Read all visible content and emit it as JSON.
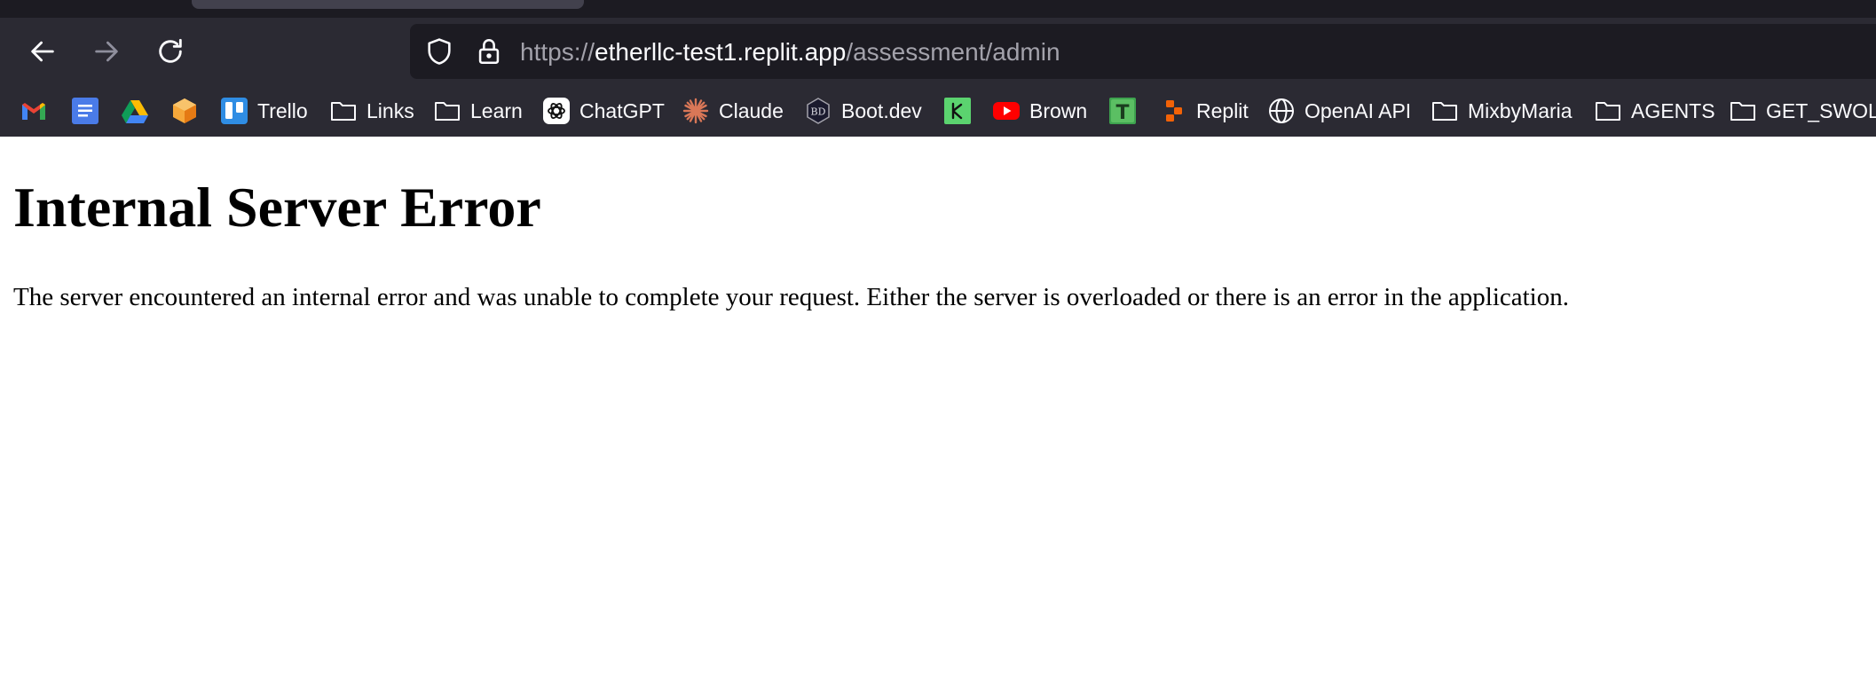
{
  "browser": {
    "url": {
      "scheme": "https://",
      "host": "etherllc-test1.replit.app",
      "path": "/assessment/admin"
    },
    "icons": {
      "back": "back-arrow-icon",
      "forward": "forward-arrow-icon",
      "reload": "reload-icon",
      "shield": "shield-icon",
      "lock": "lock-icon"
    },
    "colors": {
      "toolbar": "#2b2a33",
      "urlbar": "#1c1b22",
      "text": "#fbfbfe"
    }
  },
  "bookmarks": [
    {
      "label": "",
      "icon": "gmail-icon"
    },
    {
      "label": "",
      "icon": "google-docs-icon"
    },
    {
      "label": "",
      "icon": "google-drive-icon"
    },
    {
      "label": "",
      "icon": "orange-box-icon"
    },
    {
      "label": "Trello",
      "icon": "trello-icon"
    },
    {
      "label": "Links",
      "icon": "folder-icon"
    },
    {
      "label": "Learn",
      "icon": "folder-icon"
    },
    {
      "label": "ChatGPT",
      "icon": "chatgpt-icon"
    },
    {
      "label": "Claude",
      "icon": "claude-icon"
    },
    {
      "label": "Boot.dev",
      "icon": "bootdev-icon"
    },
    {
      "label": "",
      "icon": "green-square-icon"
    },
    {
      "label": "Brown",
      "icon": "youtube-icon"
    },
    {
      "label": "",
      "icon": "green-t-icon"
    },
    {
      "label": "Replit",
      "icon": "replit-icon"
    },
    {
      "label": "OpenAI API",
      "icon": "globe-icon"
    },
    {
      "label": "MixbyMaria",
      "icon": "folder-icon"
    },
    {
      "label": "AGENTS",
      "icon": "folder-icon"
    },
    {
      "label": "GET_SWOLE",
      "icon": "folder-icon"
    }
  ],
  "page": {
    "title": "Internal Server Error",
    "message": "The server encountered an internal error and was unable to complete your request. Either the server is overloaded or there is an error in the application."
  }
}
